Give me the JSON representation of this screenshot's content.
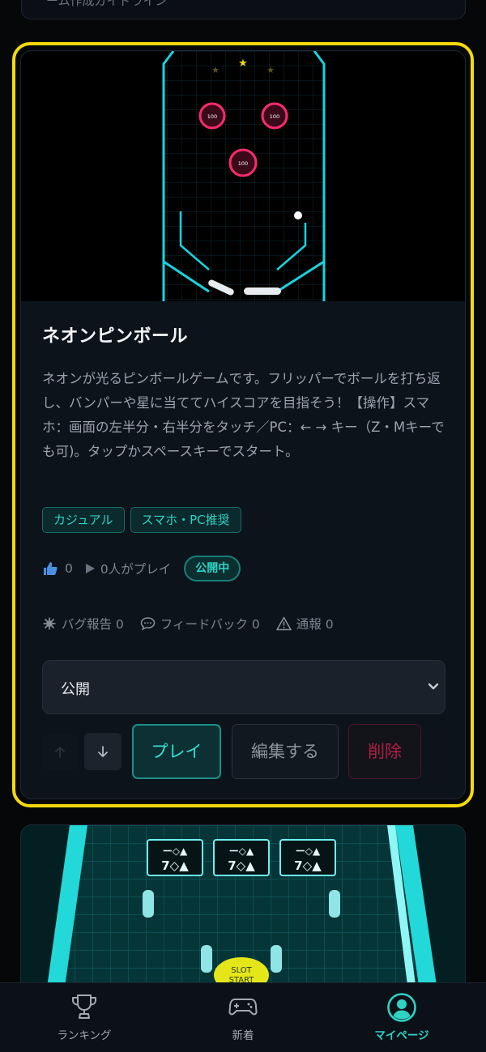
{
  "previous_card": {
    "snippet": "ーム作成ガイドライン"
  },
  "game": {
    "title": "ネオンピンボール",
    "description": "ネオンが光るピンボールゲームです。フリッパーでボールを打ち返し、バンパーや星に当ててハイスコアを目指そう！【操作】スマホ：画面の左半分・右半分をタッチ／PC：← → キー（Z・Mキーでも可)。タップかスペースキーでスタート。",
    "thumbnail": {
      "bumper_label": "100"
    },
    "tags": [
      "カジュアル",
      "スマホ・PC推奨"
    ],
    "likes": "0",
    "plays": "0人がプレイ",
    "status_badge": "公開中",
    "reports": {
      "bug_label": "バグ報告 0",
      "feedback_label": "フィードバック 0",
      "report_label": "通報 0"
    },
    "visibility_select": {
      "value": "公開"
    },
    "actions": {
      "play_label": "プレイ",
      "edit_label": "編集する",
      "delete_label": "削除"
    }
  },
  "next_card": {
    "slot_symbols": [
      "ー◇▲",
      "7◇▲"
    ],
    "slot_button": [
      "SLOT",
      "START"
    ]
  },
  "bottom_nav": {
    "items": [
      {
        "label": "ランキング",
        "icon": "trophy-icon",
        "active": false
      },
      {
        "label": "新着",
        "icon": "gamepad-icon",
        "active": false
      },
      {
        "label": "マイページ",
        "icon": "user-circle-icon",
        "active": true
      }
    ]
  },
  "colors": {
    "accent": "#2fd3c4",
    "highlight": "#f5d90a",
    "danger": "#b31e44",
    "bumper": "#ff2a6d",
    "neon": "#17d4e0"
  }
}
